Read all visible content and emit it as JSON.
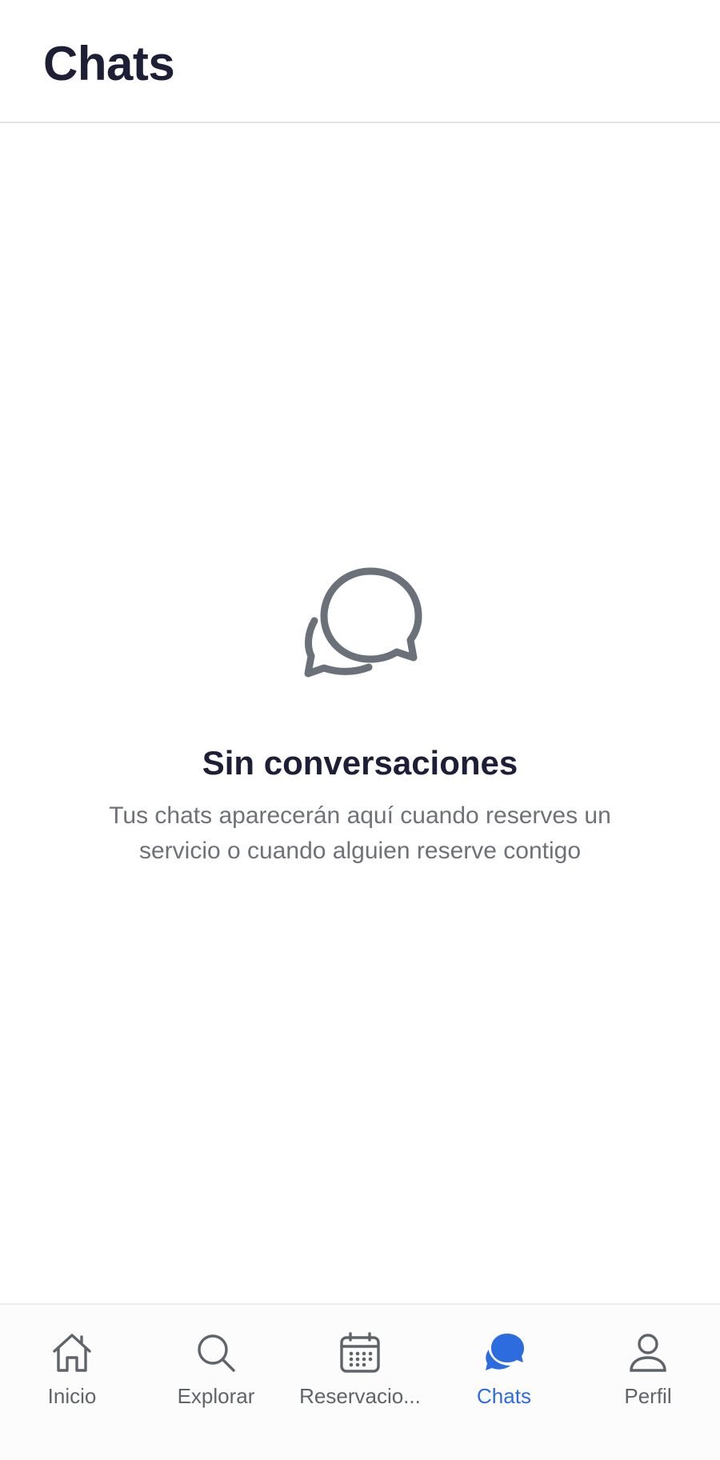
{
  "header": {
    "title": "Chats"
  },
  "empty_state": {
    "icon": "chat-bubbles-outline-icon",
    "title": "Sin conversaciones",
    "subtitle": "Tus chats aparecerán aquí cuando reserves un servicio o cuando alguien reserve contigo"
  },
  "tabbar": {
    "active": "Chats",
    "items": [
      {
        "label": "Inicio",
        "icon": "home-icon"
      },
      {
        "label": "Explorar",
        "icon": "search-icon"
      },
      {
        "label": "Reservacio...",
        "icon": "calendar-icon"
      },
      {
        "label": "Chats",
        "icon": "chat-bubbles-filled-icon"
      },
      {
        "label": "Perfil",
        "icon": "person-icon"
      }
    ]
  },
  "colors": {
    "text_primary": "#1d1f36",
    "text_secondary": "#6e7278",
    "icon_gray": "#6b7179",
    "accent": "#2d6cdf",
    "divider": "#e3e4e8"
  }
}
